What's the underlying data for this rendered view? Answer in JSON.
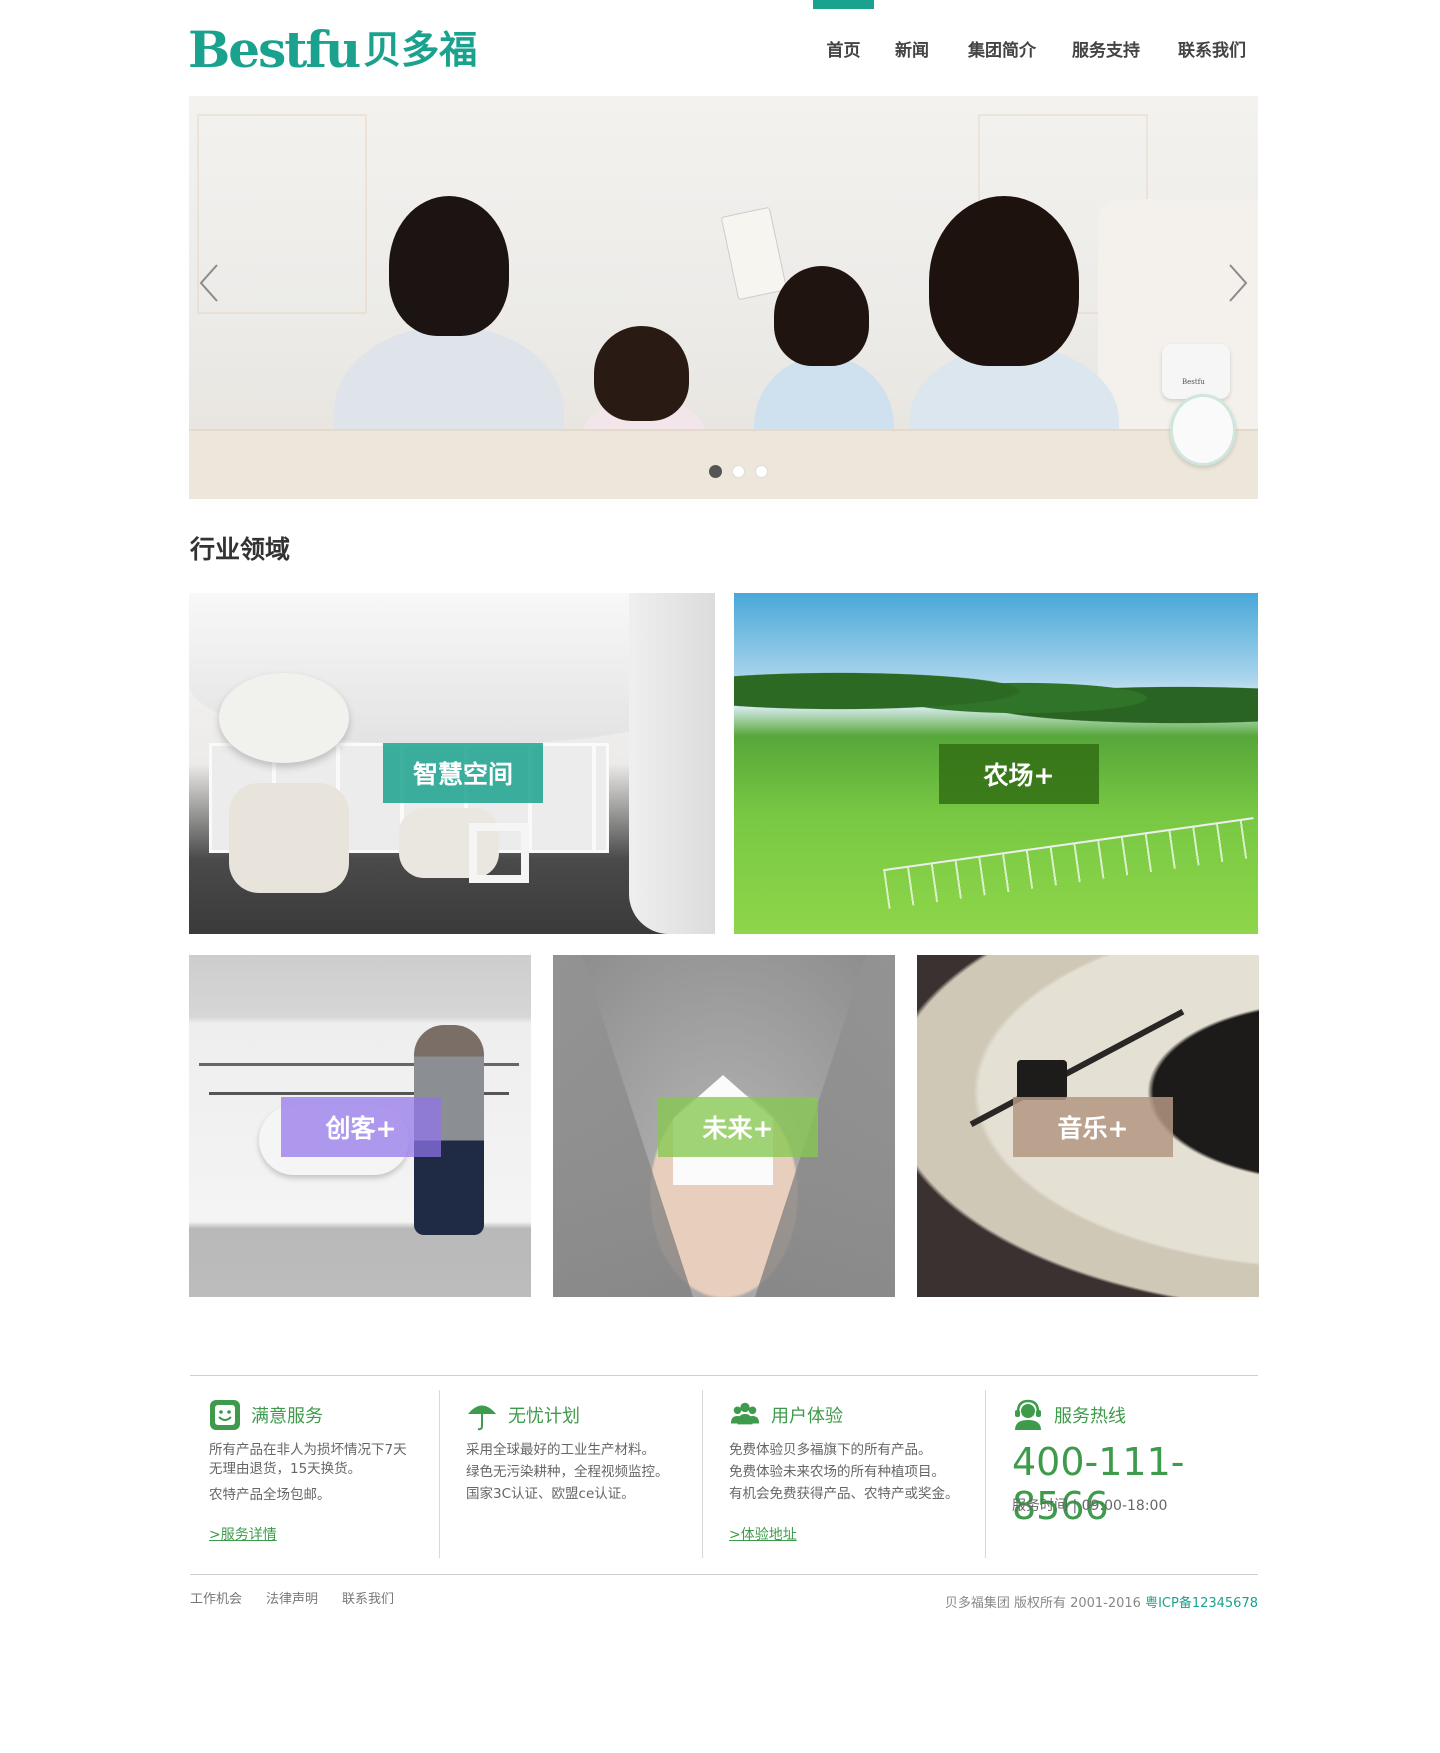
{
  "brand": {
    "name_en": "Bestfu",
    "name_cn": "贝多福",
    "color": "#1ba28f"
  },
  "nav": {
    "items": [
      {
        "label": "首页",
        "active": true
      },
      {
        "label": "新闻",
        "active": false
      },
      {
        "label": "集团简介",
        "active": false
      },
      {
        "label": "服务支持",
        "active": false
      },
      {
        "label": "联系我们",
        "active": false
      }
    ]
  },
  "banner": {
    "prev_icon": "chevron-left-icon",
    "next_icon": "chevron-right-icon",
    "device_label": "Bestfu",
    "slide_count": 3,
    "active_slide": 1
  },
  "section": {
    "title": "行业领域"
  },
  "tiles": [
    {
      "label": "智慧空间",
      "accent": "#1ba28f"
    },
    {
      "label": "农场+",
      "accent": "#326e14"
    },
    {
      "label": "创客+",
      "accent": "#9274eb"
    },
    {
      "label": "未来+",
      "accent": "#87c850"
    },
    {
      "label": "音乐+",
      "accent": "#b49682"
    }
  ],
  "features": [
    {
      "icon": "smile-face-icon",
      "title": "满意服务",
      "lines": [
        "所有产品在非人为损坏情况下7天",
        "无理由退货，15天换货。",
        "农特产品全场包邮。"
      ],
      "link": ">服务详情"
    },
    {
      "icon": "umbrella-icon",
      "title": "无忧计划",
      "lines": [
        "采用全球最好的工业生产材料。",
        "绿色无污染耕种，全程视频监控。",
        "国家3C认证、欧盟ce认证。"
      ]
    },
    {
      "icon": "users-icon",
      "title": "用户体验",
      "lines": [
        "免费体验贝多福旗下的所有产品。",
        "免费体验未来农场的所有种植项目。",
        "有机会免费获得产品、农特产或奖金。"
      ],
      "link": ">体验地址"
    },
    {
      "icon": "headset-icon",
      "title": "服务热线",
      "phone": "400-111-8566",
      "hours": "服务时间 | 09:00-18:00"
    }
  ],
  "accent_green": "#3f9b4c",
  "footer": {
    "links": [
      "工作机会",
      "法律声明",
      "联系我们"
    ],
    "copyright": "贝多福集团 版权所有 2001-2016",
    "icp": "粤ICP备12345678"
  }
}
